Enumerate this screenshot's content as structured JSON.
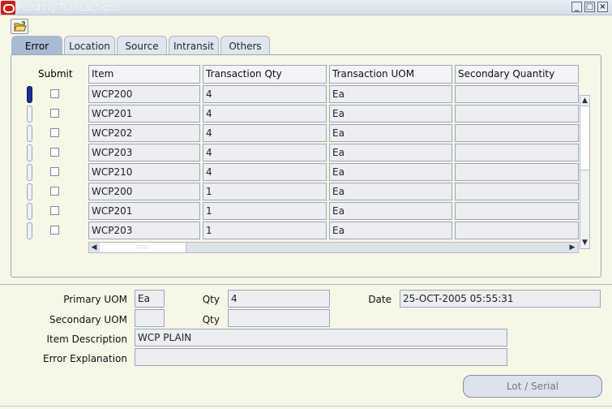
{
  "window": {
    "title": "Pending Transactions",
    "controls": [
      "minimize-icon",
      "maximize-icon",
      "close-icon"
    ]
  },
  "toolbar": {
    "folder_icon": "folder-open-icon"
  },
  "tabs": [
    {
      "label": "Error",
      "active": true
    },
    {
      "label": "Location",
      "active": false
    },
    {
      "label": "Source",
      "active": false
    },
    {
      "label": "Intransit",
      "active": false
    },
    {
      "label": "Others",
      "active": false
    }
  ],
  "grid": {
    "submit_header": "Submit",
    "columns": [
      "Item",
      "Transaction Qty",
      "Transaction UOM",
      "Secondary Quantity"
    ],
    "rows": [
      {
        "item": "WCP200",
        "qty": "4",
        "uom": "Ea",
        "secondary": ""
      },
      {
        "item": "WCP201",
        "qty": "4",
        "uom": "Ea",
        "secondary": ""
      },
      {
        "item": "WCP202",
        "qty": "4",
        "uom": "Ea",
        "secondary": ""
      },
      {
        "item": "WCP203",
        "qty": "4",
        "uom": "Ea",
        "secondary": ""
      },
      {
        "item": "WCP210",
        "qty": "4",
        "uom": "Ea",
        "secondary": ""
      },
      {
        "item": "WCP200",
        "qty": "1",
        "uom": "Ea",
        "secondary": ""
      },
      {
        "item": "WCP201",
        "qty": "1",
        "uom": "Ea",
        "secondary": ""
      },
      {
        "item": "WCP203",
        "qty": "1",
        "uom": "Ea",
        "secondary": ""
      }
    ],
    "current_row": 0
  },
  "details": {
    "primary_uom_label": "Primary UOM",
    "primary_uom": "Ea",
    "qty_label": "Qty",
    "qty": "4",
    "date_label": "Date",
    "date": "25-OCT-2005 05:55:31",
    "secondary_uom_label": "Secondary UOM",
    "secondary_uom": "",
    "secondary_qty_label": "Qty",
    "secondary_qty": "",
    "item_description_label": "Item Description",
    "item_description": "WCP PLAIN",
    "error_explanation_label": "Error Explanation",
    "error_explanation": ""
  },
  "buttons": {
    "lot_serial": "Lot / Serial"
  },
  "colors": {
    "background": "#f7f7e7",
    "active_tab": "#a9bbd3",
    "current_row": "#1d2f8f"
  }
}
